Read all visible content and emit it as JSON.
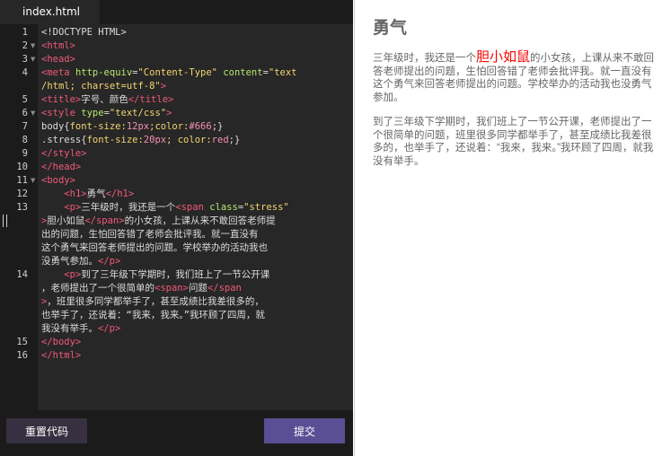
{
  "tab": {
    "label": "index.html"
  },
  "line_numbers": [
    "1",
    "2",
    "3",
    "4",
    "5",
    "6",
    "7",
    "8",
    "9",
    "10",
    "11",
    "12",
    "13",
    "14",
    "15",
    "16"
  ],
  "buttons": {
    "reset": "重置代码",
    "submit": "提交"
  },
  "preview": {
    "heading": "勇气",
    "p1_before": "三年级时，我还是一个",
    "p1_stress": "胆小如鼠",
    "p1_after": "的小女孩，上课从来不敢回答老师提出的问题，生怕回答错了老师会批评我。就一直没有这个勇气来回答老师提出的问题。学校举办的活动我也没勇气参加。",
    "p2": "到了三年级下学期时，我们班上了一节公开课，老师提出了一个很简单的问题，班里很多同学都举手了，甚至成绩比我差很多的，也举手了，还说着：“我来，我来。”我环顾了四周，就我没有举手。"
  },
  "code": {
    "l1": "<!DOCTYPE HTML>",
    "l2": "<html>",
    "l3": "<head>",
    "l4a_tag": "<meta ",
    "l4a_attr1": "http-equiv",
    "l4a_str1": "\"Content-Type\"",
    "l4a_attr2": " content",
    "l4a_str2": "\"text",
    "l4b_str": "/html; charset=utf-8\"",
    "l4b_tag": ">",
    "l5_open": "<title>",
    "l5_text": "字号、颜色",
    "l5_close": "</title>",
    "l6_tag": "<style ",
    "l6_attr": "type",
    "l6_str": "\"text/css\"",
    "l6_end": ">",
    "l7_sel": "body{",
    "l7_p1": "font-size:",
    "l7_v1": "12px",
    "l7_p2": ";color:",
    "l7_v2": "#666",
    "l7_end": ";}",
    "l8_sel": ".stress{",
    "l8_p1": "font-size:",
    "l8_v1": "20px",
    "l8_p2": "; color:",
    "l8_v2": "red",
    "l8_end": ";}",
    "l9": "</style>",
    "l10": "</head>",
    "l11": "<body>",
    "l12_open": "<h1>",
    "l12_text": "勇气",
    "l12_close": "</h1>",
    "l13a_open": "<p>",
    "l13a_text": "三年级时，我还是一个",
    "l13a_tag": "<span ",
    "l13a_attr": "class",
    "l13a_str": "\"stress\"",
    "l13b_tag": ">",
    "l13b_text": "胆小如鼠",
    "l13b_close": "</span>",
    "l13b_rest": "的小女孩，上课从来不敢回答老师提",
    "l13c": "出的问题，生怕回答错了老师会批评我。就一直没有",
    "l13d": "这个勇气来回答老师提出的问题。学校举办的活动我也",
    "l13e_text": "没勇气参加。",
    "l13e_close": "</p>",
    "l14a_open": "<p>",
    "l14a_text": "到了三年级下学期时，我们班上了一节公开课",
    "l14b_text": "，老师提出了一个很简单的",
    "l14b_tag": "<span>",
    "l14b_text2": "问题",
    "l14b_close": "</span",
    "l14c_tag": ">",
    "l14c_text": "，班里很多同学都举手了，甚至成绩比我差很多的，",
    "l14d": "也举手了，还说着：“我来，我来。”我环顾了四周，就",
    "l14e_text": "我没有举手。",
    "l14e_close": "</p>",
    "l15": "</body>",
    "l16": "</html>"
  }
}
